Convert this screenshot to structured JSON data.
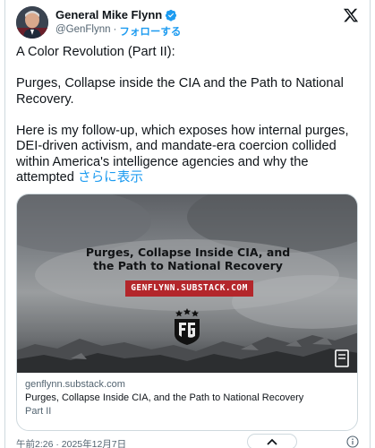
{
  "author": {
    "name": "General Mike Flynn",
    "handle": "@GenFlynn",
    "separator": "·",
    "follow_label": "フォローする"
  },
  "post": {
    "paragraphs": [
      "A Color Revolution (Part II):",
      "Purges, Collapse inside the CIA and the Path to National Recovery.",
      "Here is my follow-up, which exposes how internal purges, DEI-driven activism, and mandate-era coercion collided within America's intelligence agencies and why the attempted"
    ],
    "show_more_label": "さらに表示"
  },
  "link_card": {
    "image_title_line1": "Purges, Collapse Inside CIA, and",
    "image_title_line2": "the Path to National Recovery",
    "image_url_banner": "GENFLYNN.SUBSTACK.COM",
    "domain": "genflynn.substack.com",
    "title": "Purges, Collapse Inside CIA, and the Path to National Recovery",
    "description": "Part II"
  },
  "footer": {
    "timestamp": "午前2:26 · 2025年12月7日"
  },
  "icons": {
    "verified": "verified-badge-icon",
    "x_logo": "x-logo-icon",
    "bookmark": "bookmark-icon",
    "chevron_up": "chevron-up-icon",
    "info": "info-icon"
  },
  "colors": {
    "accent": "#1d9bf0",
    "text": "#0f1419",
    "muted": "#536471",
    "border": "#cfd9de",
    "banner": "#b3262b"
  }
}
